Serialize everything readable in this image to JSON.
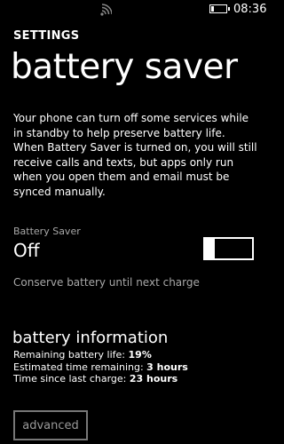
{
  "status_bar": {
    "time": "08:36",
    "battery_level_fraction": 0.19
  },
  "header": {
    "app_title": "SETTINGS",
    "page_title": "battery saver"
  },
  "description": "Your phone can turn off some services while in standby to help preserve battery life. When Battery Saver is turned on, you will still receive calls and texts, but apps only run when you open them and email must be synced manually.",
  "battery_saver": {
    "label": "Battery Saver",
    "state": "Off",
    "enabled": false
  },
  "conserve_option": "Conserve battery until next charge",
  "battery_information": {
    "title": "battery information",
    "remaining_life_label": "Remaining battery life:",
    "remaining_life_value": "19%",
    "estimated_time_label": "Estimated time remaining:",
    "estimated_time_value": "3 hours",
    "since_charge_label": "Time since last charge:",
    "since_charge_value": "23 hours"
  },
  "advanced_button_label": "advanced"
}
